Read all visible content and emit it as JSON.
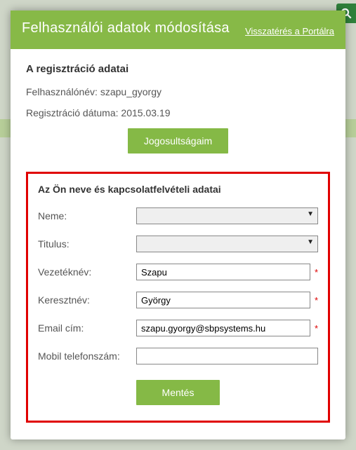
{
  "modal": {
    "title": "Felhasználói adatok módosítása",
    "back_link": "Visszatérés a Portálra"
  },
  "registration": {
    "heading": "A regisztráció adatai",
    "username_label": "Felhasználónév: ",
    "username": "szapu_gyorgy",
    "regdate_label": "Regisztráció dátuma: ",
    "regdate": "2015.03.19",
    "permissions_button": "Jogosultságaim"
  },
  "contact": {
    "heading": "Az Ön neve és kapcsolatfelvételi adatai",
    "fields": {
      "gender": {
        "label": "Neme:",
        "value": ""
      },
      "title": {
        "label": "Titulus:",
        "value": ""
      },
      "lastname": {
        "label": "Vezetéknév:",
        "value": "Szapu",
        "required": true
      },
      "firstname": {
        "label": "Keresztnév:",
        "value": "György",
        "required": true
      },
      "email": {
        "label": "Email cím:",
        "value": "szapu.gyorgy@sbpsystems.hu",
        "required": true
      },
      "mobile": {
        "label": "Mobil telefonszám:",
        "value": ""
      }
    },
    "save_button": "Mentés"
  },
  "icons": {
    "search": "search-icon",
    "req_star": "*"
  }
}
